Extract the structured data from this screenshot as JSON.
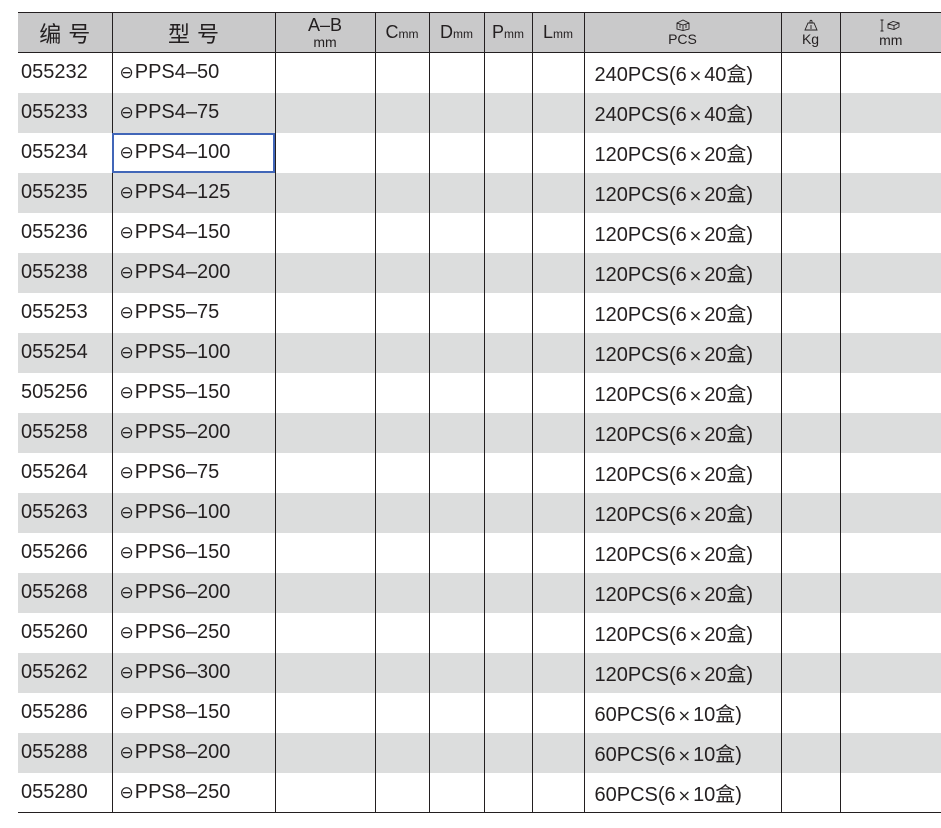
{
  "headers": {
    "code": "编 号",
    "model": "型 号",
    "ab_top": "A–B",
    "ab_unit": "mm",
    "c": "C",
    "d": "D",
    "p": "P",
    "l": "L",
    "mm": "mm",
    "pack_unit": "PCS",
    "weight_unit": "Kg",
    "size_unit": "mm",
    "pack_icon": "box-icon",
    "weight_icon": "scale-weight-icon",
    "size_icon": "carton-dimension-icon"
  },
  "rows": [
    {
      "code": "055232",
      "model": "PPS4–50",
      "qty": "240PCS(6",
      "box": "40盒)"
    },
    {
      "code": "055233",
      "model": "PPS4–75",
      "qty": "240PCS(6",
      "box": "40盒)"
    },
    {
      "code": "055234",
      "model": "PPS4–100",
      "qty": "120PCS(6",
      "box": "20盒)"
    },
    {
      "code": "055235",
      "model": "PPS4–125",
      "qty": "120PCS(6",
      "box": "20盒)"
    },
    {
      "code": "055236",
      "model": "PPS4–150",
      "qty": "120PCS(6",
      "box": "20盒)"
    },
    {
      "code": "055238",
      "model": "PPS4–200",
      "qty": "120PCS(6",
      "box": "20盒)"
    },
    {
      "code": "055253",
      "model": "PPS5–75",
      "qty": "120PCS(6",
      "box": "20盒)"
    },
    {
      "code": "055254",
      "model": "PPS5–100",
      "qty": "120PCS(6",
      "box": "20盒)"
    },
    {
      "code": "505256",
      "model": "PPS5–150",
      "qty": "120PCS(6",
      "box": "20盒)"
    },
    {
      "code": "055258",
      "model": "PPS5–200",
      "qty": "120PCS(6",
      "box": "20盒)"
    },
    {
      "code": "055264",
      "model": "PPS6–75",
      "qty": "120PCS(6",
      "box": "20盒)"
    },
    {
      "code": "055263",
      "model": "PPS6–100",
      "qty": "120PCS(6",
      "box": "20盒)"
    },
    {
      "code": "055266",
      "model": "PPS6–150",
      "qty": "120PCS(6",
      "box": "20盒)"
    },
    {
      "code": "055268",
      "model": "PPS6–200",
      "qty": "120PCS(6",
      "box": "20盒)"
    },
    {
      "code": "055260",
      "model": "PPS6–250",
      "qty": "120PCS(6",
      "box": "20盒)"
    },
    {
      "code": "055262",
      "model": "PPS6–300",
      "qty": "120PCS(6",
      "box": "20盒)"
    },
    {
      "code": "055286",
      "model": "PPS8–150",
      "qty": "60PCS(6",
      "box": "10盒)"
    },
    {
      "code": "055288",
      "model": "PPS8–200",
      "qty": "60PCS(6",
      "box": "10盒)"
    },
    {
      "code": "055280",
      "model": "PPS8–250",
      "qty": "60PCS(6",
      "box": "10盒)"
    }
  ],
  "symbols": {
    "slot_tip": "⊖",
    "times": "×"
  },
  "selected_row": 2,
  "colors": {
    "stripe": "#dcdddd",
    "header": "#c9c9ca",
    "selection": "#4166b8",
    "text": "#231f20"
  }
}
